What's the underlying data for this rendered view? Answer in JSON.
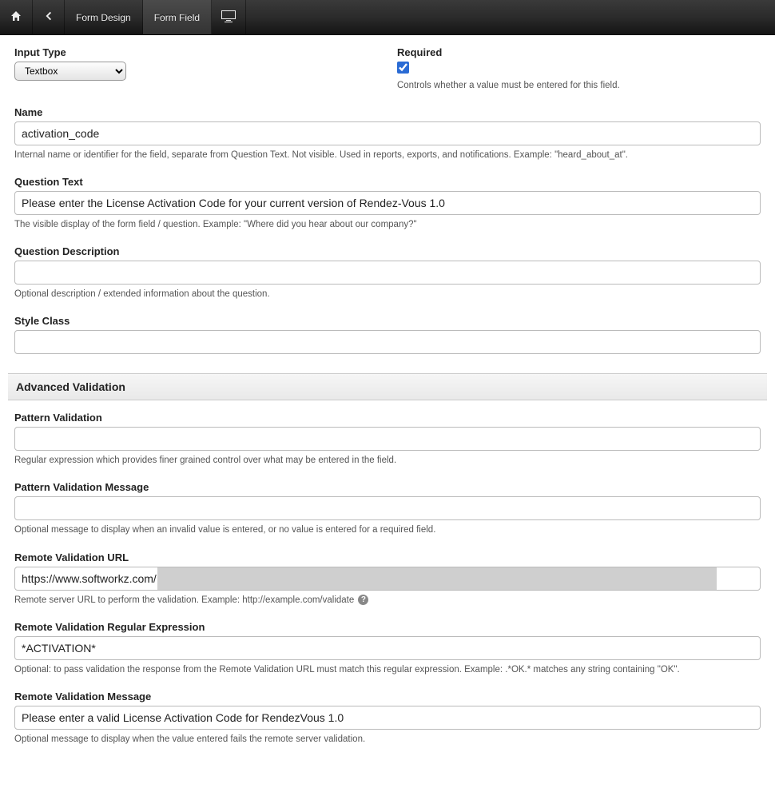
{
  "topbar": {
    "home": "home",
    "back": "back",
    "tabs": [
      {
        "label": "Form Design",
        "active": false
      },
      {
        "label": "Form Field",
        "active": true
      }
    ],
    "preview": "preview"
  },
  "form": {
    "input_type": {
      "label": "Input Type",
      "value": "Textbox",
      "options": [
        "Textbox"
      ]
    },
    "required": {
      "label": "Required",
      "checked": true,
      "help": "Controls whether a value must be entered for this field."
    },
    "name": {
      "label": "Name",
      "value": "activation_code",
      "help": "Internal name or identifier for the field, separate from Question Text. Not visible. Used in reports, exports, and notifications. Example: \"heard_about_at\"."
    },
    "question_text": {
      "label": "Question Text",
      "value": "Please enter the License Activation Code for your current version of Rendez-Vous 1.0",
      "help": "The visible display of the form field / question. Example: \"Where did you hear about our company?\""
    },
    "question_desc": {
      "label": "Question Description",
      "value": "",
      "help": "Optional description / extended information about the question."
    },
    "style_class": {
      "label": "Style Class",
      "value": ""
    }
  },
  "advanced": {
    "header": "Advanced Validation",
    "pattern": {
      "label": "Pattern Validation",
      "value": "",
      "help": "Regular expression which provides finer grained control over what may be entered in the field."
    },
    "pattern_msg": {
      "label": "Pattern Validation Message",
      "value": "",
      "help": "Optional message to display when an invalid value is entered, or no value is entered for a required field."
    },
    "remote_url": {
      "label": "Remote Validation URL",
      "value": "https://www.softworkz.com/",
      "help": "Remote server URL to perform the validation. Example: http://example.com/validate"
    },
    "remote_regex": {
      "label": "Remote Validation Regular Expression",
      "value": "*ACTIVATION*",
      "help": "Optional: to pass validation the response from the Remote Validation URL must match this regular expression. Example: .*OK.* matches any string containing \"OK\"."
    },
    "remote_msg": {
      "label": "Remote Validation Message",
      "value": "Please enter a valid License Activation Code for RendezVous 1.0",
      "help": "Optional message to display when the value entered fails the remote server validation."
    }
  }
}
